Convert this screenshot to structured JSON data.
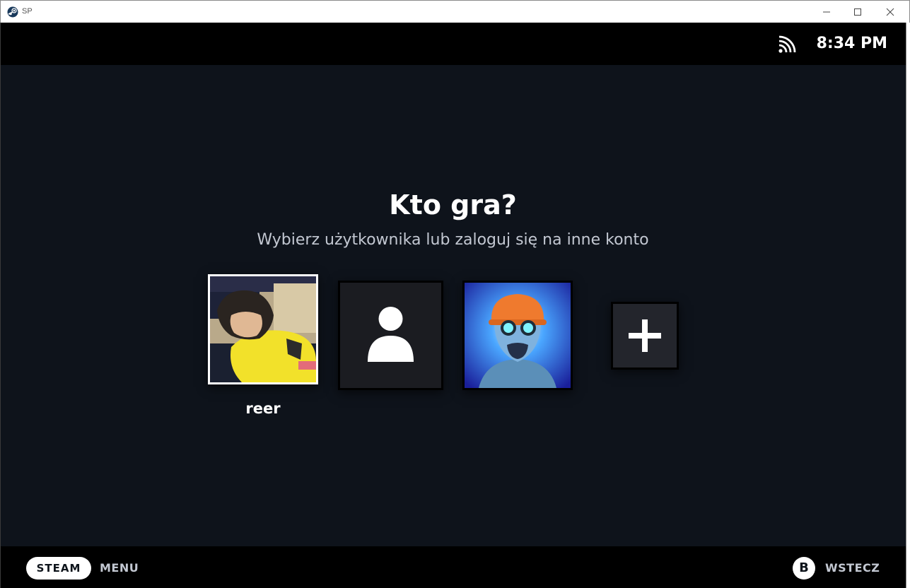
{
  "window": {
    "title": "SP",
    "controls": [
      "minimize-icon",
      "maximize-icon",
      "close-icon"
    ]
  },
  "status_bar": {
    "network_icon": "wifi-icon",
    "clock": "8:34 PM"
  },
  "account_picker": {
    "title": "Kto gra?",
    "subtitle": "Wybierz użytkownika lub zaloguj się na inne konto",
    "accounts": [
      {
        "name": "reer",
        "avatar": "user-photo",
        "selected": true
      },
      {
        "name": "",
        "avatar": "default-user-icon",
        "selected": false
      },
      {
        "name": "",
        "avatar": "game-character-portrait",
        "selected": false
      }
    ],
    "add_account_icon": "plus-icon"
  },
  "footer": {
    "steam_button": "STEAM",
    "menu_label": "MENU",
    "back_button": "B",
    "back_label": "WSTECZ"
  },
  "colors": {
    "background": "#0e131b",
    "bars": "#000000",
    "text_primary": "#ffffff",
    "text_secondary": "#c3c8d2"
  }
}
